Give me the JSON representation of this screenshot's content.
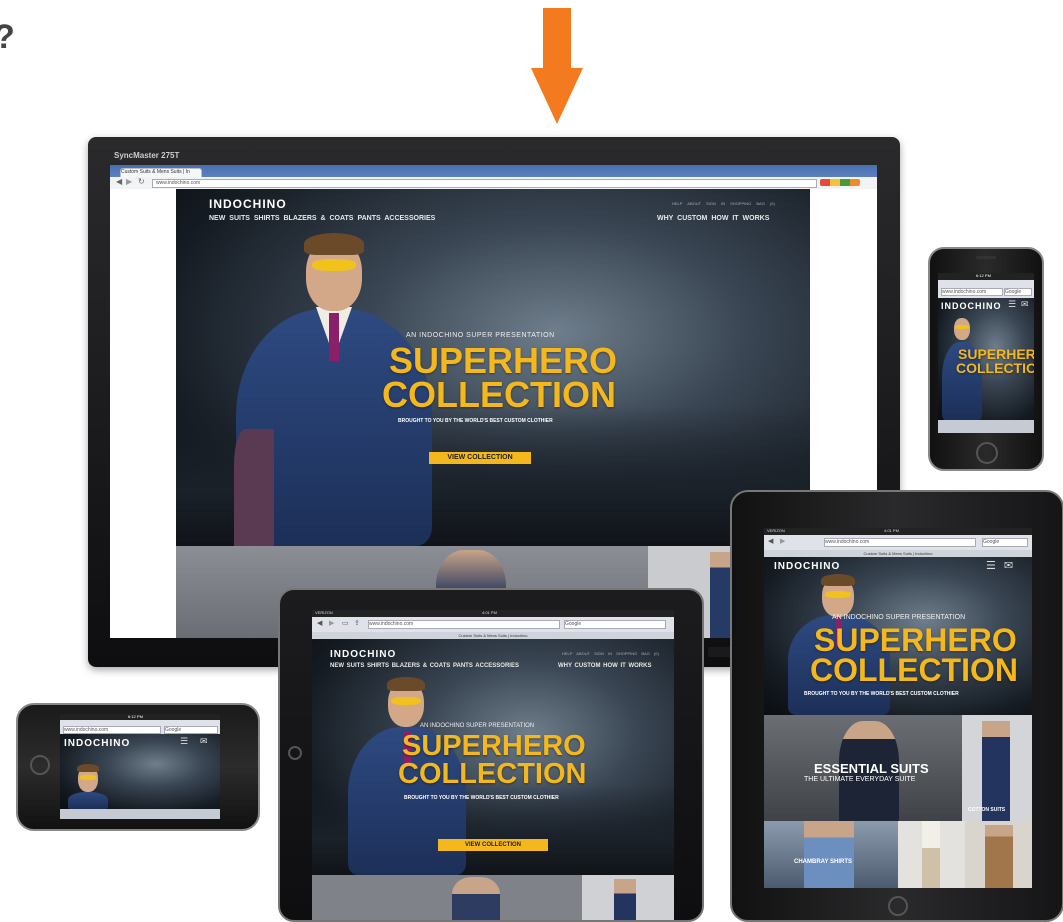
{
  "page": {
    "question_mark": "?"
  },
  "site": {
    "brand": "INDOCHINO",
    "nav_items": [
      "NEW",
      "SUITS",
      "SHIRTS",
      "BLAZERS & COATS",
      "PANTS",
      "ACCESSORIES"
    ],
    "nav_right": [
      "WHY CUSTOM",
      "HOW IT WORKS"
    ],
    "utility_links": [
      "HELP",
      "ABOUT",
      "SIGN IN",
      "SHOPPING BAG (0)"
    ],
    "kicker": "AN INDOCHINO SUPER PRESENTATION",
    "hero_title_line1": "SUPERHERO",
    "hero_title_line2": "COLLECTION",
    "hero_subline": "BROUGHT TO YOU BY THE WORLD'S BEST CUSTOM CLOTHIER",
    "cta_label": "VIEW COLLECTION",
    "url": "www.indochino.com",
    "page_title": "Custom Suits & Mens Suits | Indochino",
    "tab_label": "Custom Suits & Mens Suits | In",
    "search_placeholder": "Google"
  },
  "monitor": {
    "model": "SyncMaster 275T"
  },
  "status_bar": {
    "carrier": "VERIZON",
    "time_tablet": "4:01 PM",
    "time_phone": "6:12 PM"
  },
  "tablet_tiles": {
    "essential_title": "ESSENTIAL SUITS",
    "essential_sub": "THE ULTIMATE EVERYDAY SUITE",
    "cotton_label": "COTTON SUITS",
    "chambray_label": "CHAMBRAY SHIRTS"
  },
  "colors": {
    "accent_orange": "#f47a20",
    "hero_yellow": "#f5b81c",
    "tie_purple": "#8a1f6a",
    "suit_blue": "#2e4a82"
  },
  "icons": {
    "menu": "hamburger-icon",
    "mail": "envelope-icon",
    "back": "back-arrow-icon",
    "forward": "forward-arrow-icon",
    "bookmark": "bookmark-icon",
    "share": "share-icon",
    "home_button": "home-button-icon",
    "camera": "camera-icon"
  }
}
